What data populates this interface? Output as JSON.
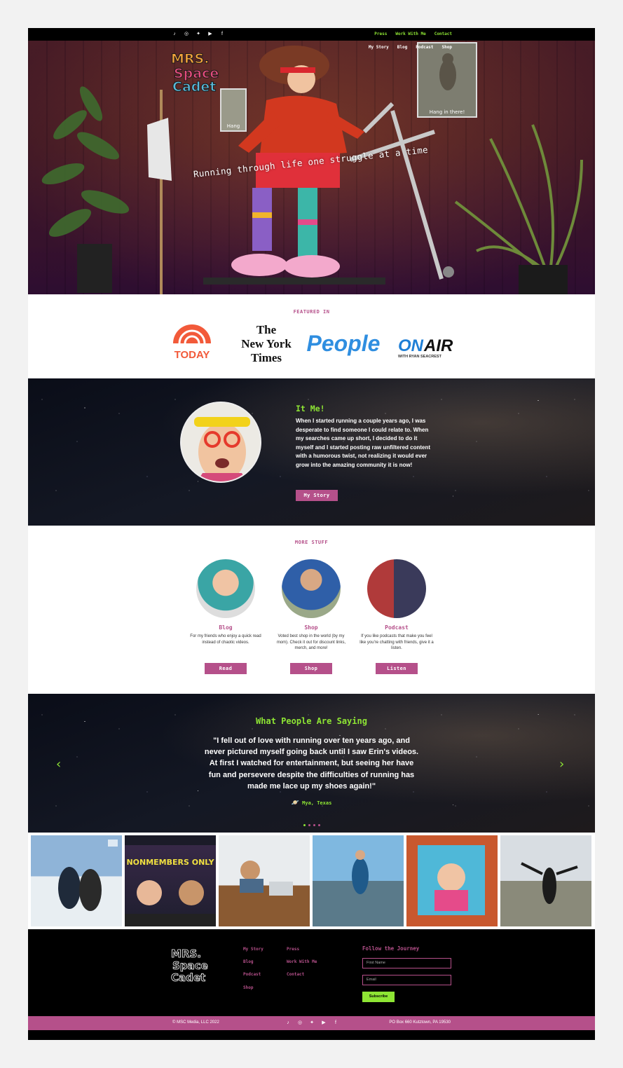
{
  "topbar": {
    "social_icons": [
      "tiktok-icon",
      "instagram-icon",
      "twitter-icon",
      "youtube-icon",
      "facebook-icon"
    ],
    "links": [
      "Press",
      "Work With Me",
      "Contact"
    ]
  },
  "nav": {
    "links": [
      "My Story",
      "Blog",
      "Podcast",
      "Shop"
    ]
  },
  "hero": {
    "logo_text": "MRS. SPACE CADET",
    "tagline": "Running through life one struggle at a time",
    "poster_right_caption": "Hang in there!",
    "poster_left_caption": "Hang"
  },
  "featured": {
    "label": "FEATURED IN",
    "logos": [
      "TODAY",
      "The New York Times",
      "People",
      "ON AIR WITH RYAN SEACREST"
    ]
  },
  "about": {
    "title": "It Me!",
    "body": "When I started running a couple years ago, I was desperate to find someone  I could relate to. When my searches came up short, I decided to do it myself and I started posting raw unfiltered content with a humorous twist, not realizing it would ever grow into the amazing community it is now!",
    "button": "My Story"
  },
  "more": {
    "label": "MORE STUFF",
    "cards": [
      {
        "title": "Blog",
        "desc": "For my friends who enjoy a quick read instead of chaotic videos.",
        "button": "Read"
      },
      {
        "title": "Shop",
        "desc": "Voted best shop in the world (by my mom). Check it out for discount links, merch, and more!",
        "button": "Shop"
      },
      {
        "title": "Podcast",
        "desc": "If you like podcasts that make you feel like you're chatting with friends, give it a listen.",
        "button": "Listen"
      }
    ]
  },
  "testimonials": {
    "title": "What People Are Saying",
    "quote": "\"I fell out of love with running over ten years ago, and never pictured myself going back until I saw Erin's videos. At first I watched for entertainment, but seeing her have fun and persevere despite the difficulties of running has made me lace up my shoes again!\"",
    "author": "Mya, Texas",
    "prev": "‹",
    "next": "›",
    "active_slide": 1,
    "slide_count": 4
  },
  "instagram": {
    "tile_2_text": "NONMEMBERS ONLY"
  },
  "footer": {
    "col1": [
      "My Story",
      "Blog",
      "Podcast",
      "Shop"
    ],
    "col2": [
      "Press",
      "Work With Me",
      "Contact"
    ],
    "follow_title": "Follow the Journey",
    "first_name_placeholder": "First Name",
    "email_placeholder": "Email",
    "subscribe": "Subscribe",
    "copyright": "© MSC Media, LLC 2022",
    "address": "PO Box 660 Kutztown, PA 19530"
  },
  "colors": {
    "accent_pink": "#b5508a",
    "accent_green": "#8ee534"
  }
}
